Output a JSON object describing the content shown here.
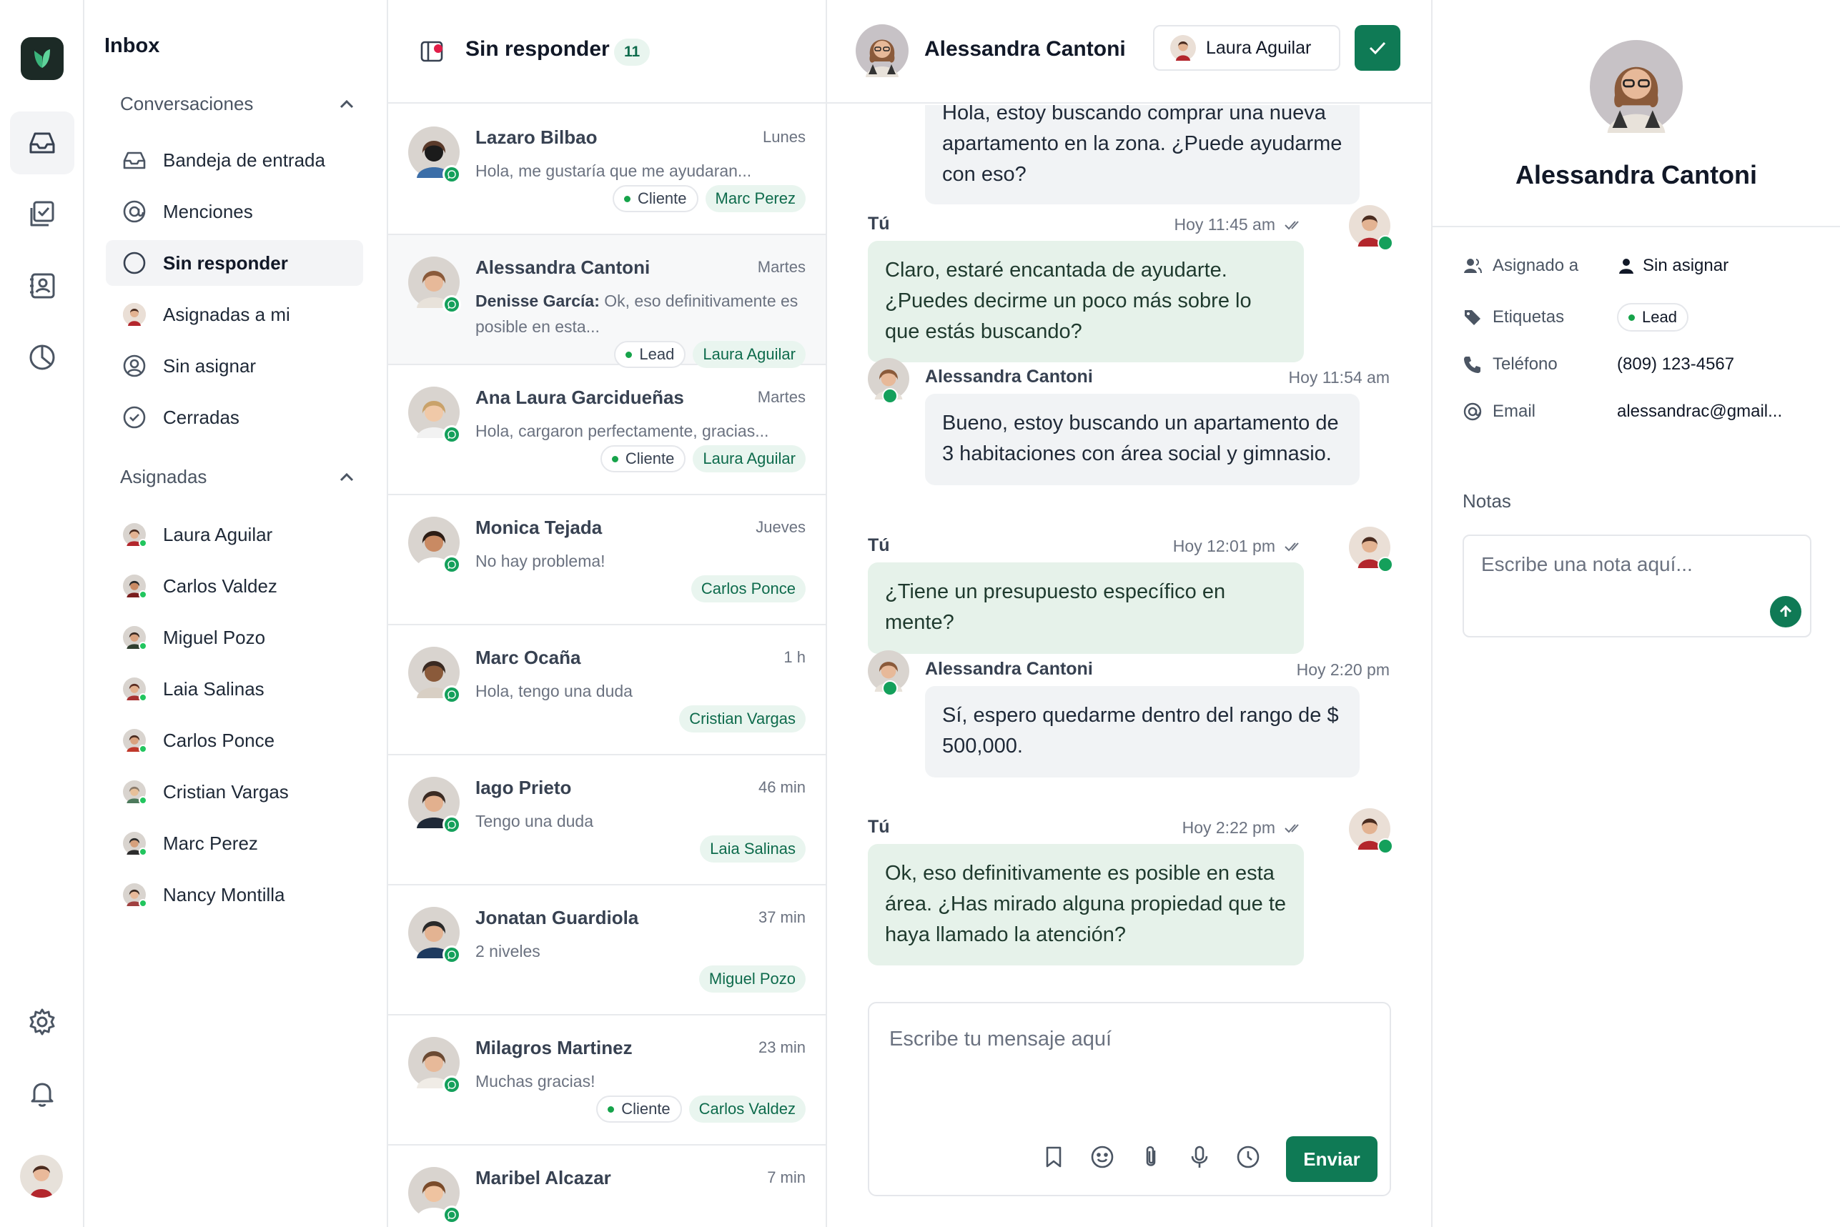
{
  "colors": {
    "accent": "#0f7a55",
    "accent_soft": "#e9f5ef",
    "whatsapp": "#14a05b",
    "online": "#22c55e"
  },
  "rail": {
    "icons": [
      "logo-icon",
      "inbox-icon",
      "tasks-icon",
      "contacts-icon",
      "reports-icon",
      "settings-icon",
      "bell-icon",
      "user-avatar"
    ]
  },
  "nav": {
    "title": "Inbox",
    "conversaciones_label": "Conversaciones",
    "items": [
      {
        "label": "Bandeja de entrada",
        "icon": "inbox-icon"
      },
      {
        "label": "Menciones",
        "icon": "at-icon"
      },
      {
        "label": "Sin responder",
        "icon": "circle-icon"
      },
      {
        "label": "Asignadas a mi",
        "icon": "avatar"
      },
      {
        "label": "Sin asignar",
        "icon": "user-circle-icon"
      },
      {
        "label": "Cerradas",
        "icon": "check-circle-icon"
      }
    ],
    "asignadas_label": "Asignadas",
    "agents": [
      "Laura Aguilar",
      "Carlos Valdez",
      "Miguel Pozo",
      "Laia Salinas",
      "Carlos Ponce",
      "Cristian Vargas",
      "Marc Perez",
      "Nancy Montilla"
    ]
  },
  "list": {
    "title": "Sin responder",
    "count": "11",
    "conversations": [
      {
        "name": "Lazaro Bilbao",
        "time": "Lunes",
        "preview": "Hola, me gustaría que me ayudaran...",
        "sender": "",
        "label": "Cliente",
        "agent": "Marc Perez"
      },
      {
        "name": "Alessandra Cantoni",
        "time": "Martes",
        "preview": "Ok, eso definitivamente es posible en esta...",
        "sender": "Denisse García:",
        "label": "Lead",
        "agent": "Laura Aguilar"
      },
      {
        "name": "Ana Laura Garcidueñas",
        "time": "Martes",
        "preview": "Hola, cargaron perfectamente, gracias...",
        "sender": "",
        "label": "Cliente",
        "agent": "Laura Aguilar"
      },
      {
        "name": "Monica Tejada",
        "time": "Jueves",
        "preview": "No hay problema!",
        "sender": "",
        "label": "",
        "agent": "Carlos Ponce"
      },
      {
        "name": "Marc Ocaña",
        "time": "1 h",
        "preview": "Hola, tengo una duda",
        "sender": "",
        "label": "",
        "agent": "Cristian Vargas"
      },
      {
        "name": "Iago Prieto",
        "time": "46 min",
        "preview": "Tengo una duda",
        "sender": "",
        "label": "",
        "agent": "Laia Salinas"
      },
      {
        "name": "Jonatan Guardiola",
        "time": "37 min",
        "preview": "2 niveles",
        "sender": "",
        "label": "",
        "agent": "Miguel Pozo"
      },
      {
        "name": "Milagros Martinez",
        "time": "23 min",
        "preview": "Muchas gracias!",
        "sender": "",
        "label": "Cliente",
        "agent": "Carlos Valdez"
      },
      {
        "name": "Maribel Alcazar",
        "time": "7 min",
        "preview": "",
        "sender": "",
        "label": "",
        "agent": ""
      }
    ]
  },
  "chat": {
    "contact_name": "Alessandra Cantoni",
    "assigned_agent": "Laura Aguilar",
    "messages": [
      {
        "who": "",
        "time": "",
        "text": "Hola, estoy buscando comprar una nueva apartamento en la zona. ¿Puede ayudarme con eso?",
        "dir": "in"
      },
      {
        "who": "Tú",
        "time": "Hoy 11:45 am",
        "text": "Claro, estaré encantada de ayudarte. ¿Puedes decirme un poco más sobre lo que estás buscando?",
        "dir": "out"
      },
      {
        "who": "Alessandra Cantoni",
        "time": "Hoy 11:54 am",
        "text": "Bueno, estoy buscando un apartamento de 3 habitaciones con área social y gimnasio.",
        "dir": "in"
      },
      {
        "who": "Tú",
        "time": "Hoy 12:01 pm",
        "text": "¿Tiene un presupuesto específico en mente?",
        "dir": "out"
      },
      {
        "who": "Alessandra Cantoni",
        "time": "Hoy 2:20 pm",
        "text": "Sí, espero quedarme dentro del rango de $ 500,000.",
        "dir": "in"
      },
      {
        "who": "Tú",
        "time": "Hoy 2:22 pm",
        "text": "Ok, eso definitivamente es posible en esta área. ¿Has mirado alguna propiedad que te haya llamado la atención?",
        "dir": "out"
      }
    ],
    "composer_placeholder": "Escribe tu mensaje aquí",
    "composer_tools": [
      "bookmark-icon",
      "emoji-icon",
      "paperclip-icon",
      "microphone-icon",
      "clock-icon"
    ],
    "send_label": "Enviar"
  },
  "profile": {
    "name": "Alessandra Cantoni",
    "assigned_label": "Asignado a",
    "assigned_value": "Sin asignar",
    "tags_label": "Etiquetas",
    "tag_value": "Lead",
    "phone_label": "Teléfono",
    "phone_value": "(809) 123-4567",
    "email_label": "Email",
    "email_value": "alessandrac@gmail...",
    "notes_label": "Notas",
    "notes_placeholder": "Escribe una nota aquí..."
  }
}
